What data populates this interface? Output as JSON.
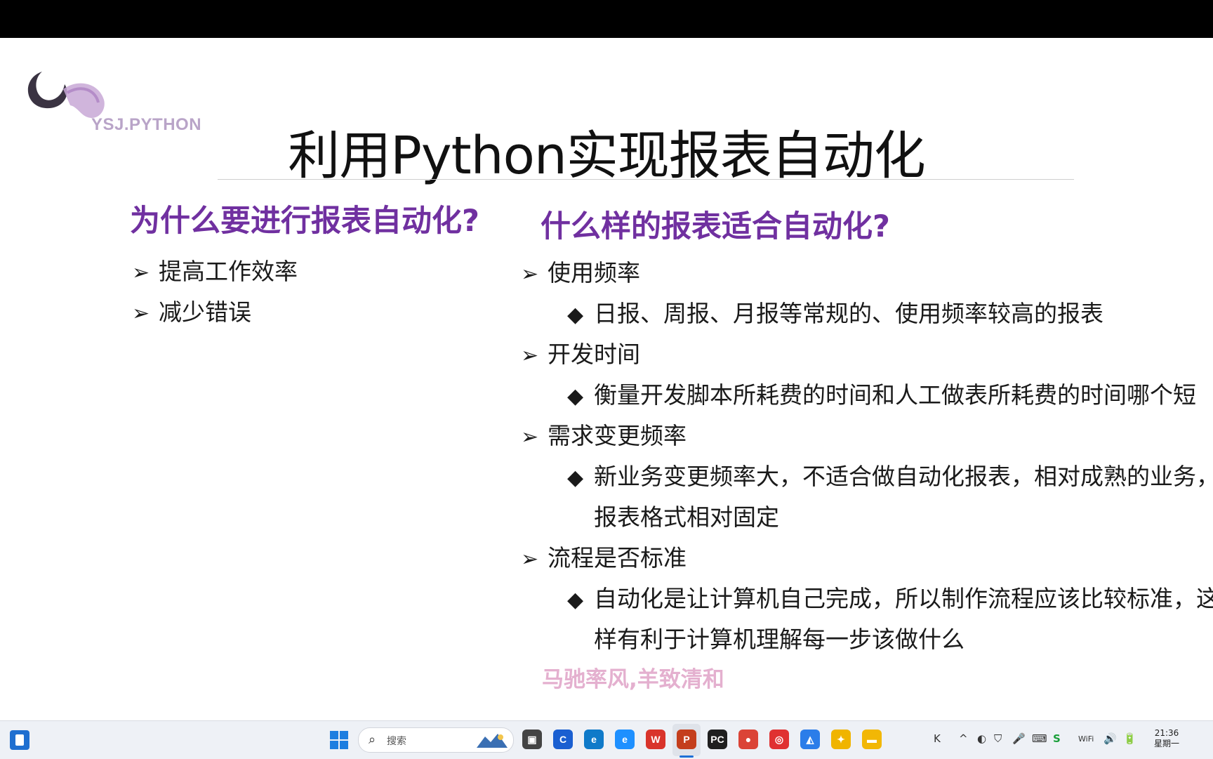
{
  "slide": {
    "logo_text": "YSJ.PYTHON",
    "title": "利用Python实现报表自动化",
    "left": {
      "heading": "为什么要进行报表自动化?",
      "items": [
        "提高工作效率",
        "减少错误"
      ]
    },
    "right": {
      "heading": "什么样的报表适合自动化?",
      "lines": [
        {
          "type": "bullet",
          "text": "使用频率"
        },
        {
          "type": "sub",
          "text": "日报、周报、月报等常规的、使用频率较高的报表"
        },
        {
          "type": "bullet",
          "text": "开发时间"
        },
        {
          "type": "sub",
          "text": "衡量开发脚本所耗费的时间和人工做表所耗费的时间哪个短"
        },
        {
          "type": "bullet",
          "text": "需求变更频率"
        },
        {
          "type": "sub",
          "text": "新业务变更频率大，不适合做自动化报表，相对成熟的业务，"
        },
        {
          "type": "cont",
          "text": "报表格式相对固定"
        },
        {
          "type": "bullet",
          "text": "流程是否标准"
        },
        {
          "type": "sub",
          "text": "自动化是让计算机自己完成，所以制作流程应该比较标准，这"
        },
        {
          "type": "cont",
          "text": "样有利于计算机理解每一步该做什么"
        }
      ]
    },
    "slogan": "马驰率风,羊致清和",
    "bullet_arrow": "➢",
    "bullet_diamond": "◆"
  },
  "colors": {
    "heading": "#7030a0",
    "slogan": "#e4b0cf",
    "logo": "#b9a4c8"
  },
  "taskbar": {
    "search_placeholder": "搜索",
    "apps": [
      {
        "name": "task-view",
        "glyph": "▣",
        "color": "#444444"
      },
      {
        "name": "app-blue-c",
        "glyph": "C",
        "color": "#1a5fd1"
      },
      {
        "name": "edge",
        "glyph": "e",
        "color": "#0f7ac9"
      },
      {
        "name": "edge-legacy",
        "glyph": "e",
        "color": "#1e90ff"
      },
      {
        "name": "wps",
        "glyph": "W",
        "color": "#d9342b"
      },
      {
        "name": "powerpoint",
        "glyph": "P",
        "color": "#c43e1c"
      },
      {
        "name": "pycharm",
        "glyph": "PC",
        "color": "#1f1f1f"
      },
      {
        "name": "chrome",
        "glyph": "●",
        "color": "#db4437"
      },
      {
        "name": "app-red",
        "glyph": "◎",
        "color": "#e03131"
      },
      {
        "name": "app-image",
        "glyph": "◭",
        "color": "#2b7de9"
      },
      {
        "name": "app-green",
        "glyph": "✦",
        "color": "#f0b400"
      },
      {
        "name": "file-explorer",
        "glyph": "▬",
        "color": "#f2b705"
      }
    ],
    "tray": [
      "K",
      "^",
      "◐",
      "⛉",
      "🎤",
      "⌨",
      "S",
      "WiFi",
      "🔊",
      "🔋"
    ],
    "time": "21:36",
    "date": "星期一"
  }
}
